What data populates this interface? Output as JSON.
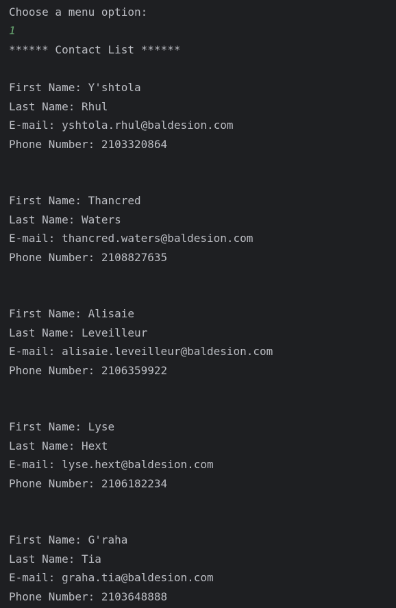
{
  "prompt": "Choose a menu option:",
  "user_input": "1",
  "header": "****** Contact List ******",
  "labels": {
    "first_name": "First Name: ",
    "last_name": "Last Name: ",
    "email": "E-mail: ",
    "phone": "Phone Number: "
  },
  "contacts": [
    {
      "first_name": "Y'shtola",
      "last_name": "Rhul",
      "email": "yshtola.rhul@baldesion.com",
      "phone": "2103320864"
    },
    {
      "first_name": "Thancred",
      "last_name": "Waters",
      "email": "thancred.waters@baldesion.com",
      "phone": "2108827635"
    },
    {
      "first_name": "Alisaie",
      "last_name": "Leveilleur",
      "email": "alisaie.leveilleur@baldesion.com",
      "phone": "2106359922"
    },
    {
      "first_name": "Lyse",
      "last_name": "Hext",
      "email": "lyse.hext@baldesion.com",
      "phone": "2106182234"
    },
    {
      "first_name": "G'raha",
      "last_name": "Tia",
      "email": "graha.tia@baldesion.com",
      "phone": "2103648888"
    }
  ]
}
